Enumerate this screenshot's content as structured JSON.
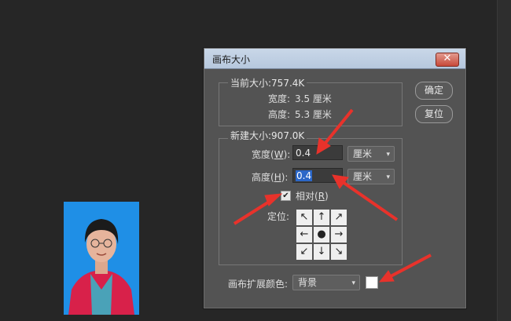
{
  "dialog": {
    "title": "画布大小",
    "close_glyph": "✕",
    "ok_label": "确定",
    "reset_label": "复位"
  },
  "current_size": {
    "group_label": "当前大小:757.4K",
    "width_label": "宽度:",
    "width_value": "3.5 厘米",
    "height_label": "高度:",
    "height_value": "5.3 厘米"
  },
  "new_size": {
    "group_label": "新建大小:907.0K",
    "width_label": "宽度(",
    "width_hotkey": "W",
    "width_suffix": "):",
    "width_value": "0.4",
    "width_unit": "厘米",
    "height_label": "高度(",
    "height_hotkey": "H",
    "height_suffix": "):",
    "height_value": "0.4",
    "height_unit": "厘米",
    "relative_label": "相对(",
    "relative_hotkey": "R",
    "relative_suffix": ")",
    "relative_checked": true,
    "relative_check_glyph": "✔",
    "anchor_label": "定位:",
    "anchor_cells": [
      "↖",
      "↑",
      "↗",
      "←",
      "●",
      "→",
      "↙",
      "↓",
      "↘"
    ]
  },
  "canvas_extension": {
    "label": "画布扩展颜色:",
    "value": "背景",
    "swatch_color": "#ffffff"
  },
  "colors": {
    "annotation_arrow": "#e8322b",
    "selection": "#2b67c8"
  },
  "icons": {
    "dropdown": "▾"
  }
}
